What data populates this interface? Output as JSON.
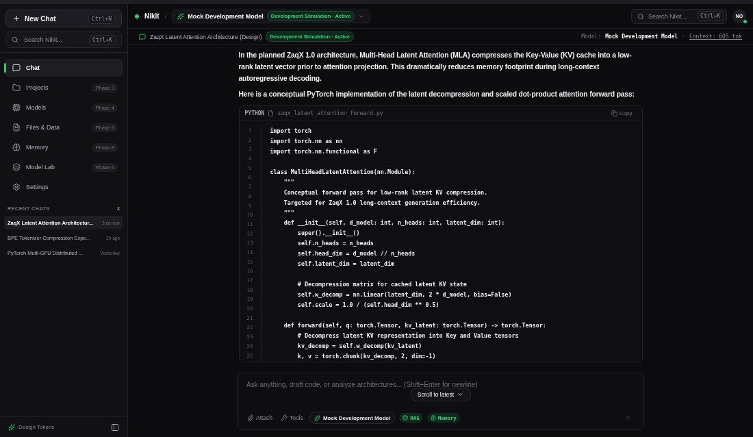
{
  "sidebar": {
    "new_chat": {
      "label": "New Chat",
      "shortcut": "Ctrl+N"
    },
    "search": {
      "placeholder": "Search Nikit...",
      "shortcut": "Ctrl+K"
    },
    "nav": [
      {
        "kind": "chat",
        "label": "Chat",
        "selected": true
      },
      {
        "kind": "folder",
        "label": "Projects",
        "badge": "Phase 3",
        "selected": false
      },
      {
        "kind": "chip",
        "label": "Models",
        "badge": "Phase 4",
        "selected": false
      },
      {
        "kind": "file",
        "label": "Files & Data",
        "badge": "Phase 5",
        "selected": false
      },
      {
        "kind": "brain",
        "label": "Memory",
        "badge": "Phase 8",
        "selected": false
      },
      {
        "kind": "layers",
        "label": "Model Lab",
        "badge": "Phase 6",
        "selected": false
      },
      {
        "kind": "gear",
        "label": "Settings",
        "selected": false
      }
    ],
    "recent_title": "RECENT CHATS",
    "recent_count": "3",
    "recent": [
      {
        "title": "ZaqX Latent Attention Architectur...",
        "time": "Just now",
        "selected": true
      },
      {
        "title": "BPE Tokenizer Compression Expe...",
        "time": "2h ago",
        "selected": false
      },
      {
        "title": "PyTorch Multi-GPU Distributed ...",
        "time": "Yesterday",
        "selected": false
      }
    ],
    "footer": {
      "label": "Design Tokens"
    }
  },
  "header": {
    "workspace": "Nikit",
    "separator": "/",
    "model": "Mock Development Model",
    "status": "Development Simulation · Active",
    "search_placeholder": "Search Nikit...",
    "search_shortcut": "Ctrl+K",
    "avatar": "NO"
  },
  "chat_bar": {
    "title": "ZaqX Latent Attention Architecture (Design)",
    "status": "Development Simulation · Active",
    "model_label": "Model:",
    "model": "Mock Development Model",
    "separator": "·",
    "context": "Context: 605 tok"
  },
  "message": {
    "paragraphs": [
      "In the planned ZaqX 1.0 architecture, Multi-Head Latent Attention (MLA) compresses the Key-Value (KV) cache into a low-rank latent vector prior to attention projection. This dramatically reduces memory footprint during long-context autoregressive decoding.",
      "Here is a conceptual PyTorch implementation of the latent decompression and scaled dot-product attention forward pass:"
    ],
    "code": {
      "language": "PYTHON",
      "filename": "zaqx_latent_attention_forward.py",
      "copy": "Copy",
      "line_numbers": [
        "1",
        "2",
        "3",
        "4",
        "5",
        "6",
        "7",
        "8",
        "9",
        "10",
        "11",
        "12",
        "13",
        "14",
        "15",
        "16",
        "17",
        "18",
        "19",
        "20",
        "21",
        "22",
        "23",
        "24",
        "25"
      ],
      "lines": [
        {
          "kind": "code",
          "text": "import torch"
        },
        {
          "kind": "code",
          "text": "import torch.nn as nn"
        },
        {
          "kind": "code",
          "text": "import torch.nn.functional as F"
        },
        {
          "kind": "blank"
        },
        {
          "kind": "code",
          "text": "class MultiHeadLatentAttention(nn.Module):"
        },
        {
          "kind": "code",
          "text": "    \"\"\""
        },
        {
          "kind": "code",
          "text": "    Conceptual forward pass for low-rank latent KV compression."
        },
        {
          "kind": "code",
          "text": "    Targeted for ZaqX 1.0 long-context generation efficiency."
        },
        {
          "kind": "code",
          "text": "    \"\"\""
        },
        {
          "kind": "code",
          "text": "    def __init__(self, d_model: int, n_heads: int, latent_dim: int):"
        },
        {
          "kind": "code",
          "text": "        super().__init__()"
        },
        {
          "kind": "code",
          "text": "        self.n_heads = n_heads"
        },
        {
          "kind": "code",
          "text": "        self.head_dim = d_model // n_heads"
        },
        {
          "kind": "code",
          "text": "        self.latent_dim = latent_dim"
        },
        {
          "kind": "blank"
        },
        {
          "kind": "code",
          "text": "        # Decompression matrix for cached latent KV state"
        },
        {
          "kind": "code",
          "text": "        self.w_decomp = nn.Linear(latent_dim, 2 * d_model, bias=False)"
        },
        {
          "kind": "code",
          "text": "        self.scale = 1.0 / (self.head_dim ** 0.5)"
        },
        {
          "kind": "blank"
        },
        {
          "kind": "code",
          "text": "    def forward(self, q: torch.Tensor, kv_latent: torch.Tensor) -> torch.Tensor:"
        },
        {
          "kind": "code",
          "text": "        # Decompress latent KV representation into Key and Value tensors"
        },
        {
          "kind": "code",
          "text": "        kv_decomp = self.w_decomp(kv_latent)"
        },
        {
          "kind": "code",
          "text": "        k, v = torch.chunk(kv_decomp, 2, dim=-1)"
        }
      ]
    }
  },
  "composer": {
    "placeholder": "Ask anything, draft code, or analyze architectures... (Shift+Enter for newline)",
    "scroll_label": "Scroll to latest",
    "attach": "Attach",
    "tools": "Tools",
    "model": "Mock Development Model",
    "chips": [
      {
        "kind": "db",
        "label": "RAG"
      },
      {
        "kind": "brain",
        "label": "Memory"
      }
    ]
  }
}
